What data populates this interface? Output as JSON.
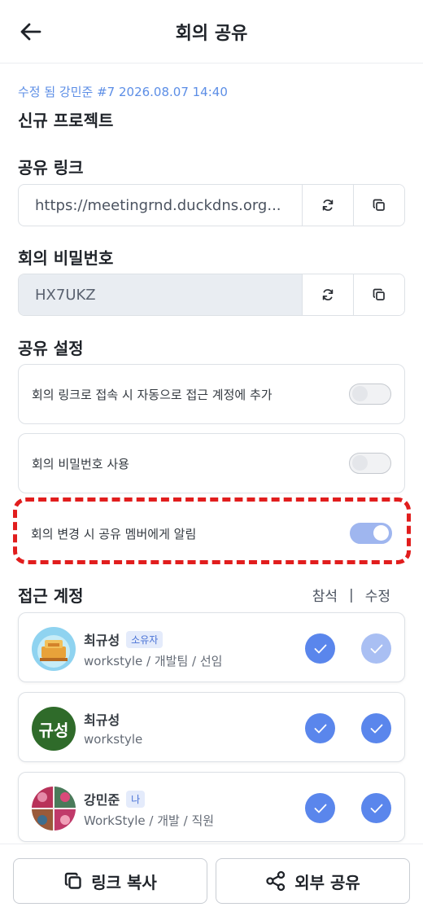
{
  "header": {
    "title": "회의 공유",
    "back_icon": "arrow-left-icon"
  },
  "meta": "수정 됨 강민준 #7 2026.08.07 14:40",
  "project_name": "신규 프로젝트",
  "share_link": {
    "label": "공유 링크",
    "value": "https://meetingrnd.duckdns.org..."
  },
  "password": {
    "label": "회의 비밀번호",
    "value": "HX7UKZ"
  },
  "settings": {
    "label": "공유 설정",
    "items": [
      {
        "label": "회의 링크로 접속 시 자동으로 접근 계정에 추가",
        "on": false
      },
      {
        "label": "회의 비밀번호 사용",
        "on": false
      },
      {
        "label": "회의 변경 시 공유 멤버에게 알림",
        "on": true
      }
    ]
  },
  "access": {
    "title": "접근 계정",
    "col_attend": "참석",
    "col_sep": "|",
    "col_edit": "수정",
    "members": [
      {
        "name": "최규성",
        "badge": "소유자",
        "sub": "workstyle / 개발팀 / 선임",
        "avatar": "illustration",
        "attend": true,
        "edit": true,
        "edit_disabled": true
      },
      {
        "name": "최규성",
        "badge": "",
        "sub": "workstyle",
        "avatar_text": "규성",
        "attend": true,
        "edit": true
      },
      {
        "name": "강민준",
        "badge": "나",
        "sub": "WorkStyle / 개발 / 직원",
        "avatar": "pattern",
        "attend": true,
        "edit": true
      }
    ]
  },
  "footer": {
    "copy_label": "링크 복사",
    "share_label": "외부 공유"
  },
  "colors": {
    "accent": "#5a86ec",
    "highlight": "#e11d1d",
    "meta": "#5c8ee6"
  }
}
